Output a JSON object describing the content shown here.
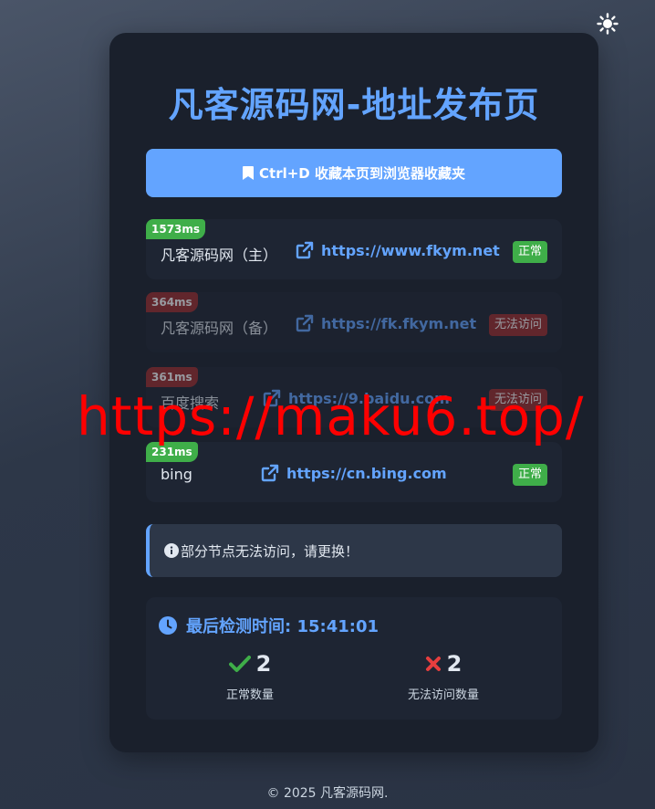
{
  "header": {
    "title": "凡客源码网-地址发布页"
  },
  "bookmark": {
    "label": "Ctrl+D 收藏本页到浏览器收藏夹"
  },
  "links": [
    {
      "latency": "1573ms",
      "name": "凡客源码网（主）",
      "url": "https://www.fkym.net",
      "status": "正常"
    },
    {
      "latency": "364ms",
      "name": "凡客源码网（备）",
      "url": "https://fk.fkym.net",
      "status": "无法访问"
    },
    {
      "latency": "361ms",
      "name": "百度搜索",
      "url": "https://9.baidu.com",
      "status": "无法访问"
    },
    {
      "latency": "231ms",
      "name": "bing",
      "url": "https://cn.bing.com",
      "status": "正常"
    }
  ],
  "notice": {
    "text": "部分节点无法访问，请更换！"
  },
  "stats": {
    "check_time": "最后检测时间: 15:41:01",
    "ok_count": "2",
    "ok_label": "正常数量",
    "bad_count": "2",
    "bad_label": "无法访问数量"
  },
  "footer": {
    "text": "© 2025 凡客源码网."
  },
  "watermark": {
    "text": "https://maku6.top/"
  },
  "colors": {
    "accent": "#63a4ff",
    "ok": "#3fae49",
    "bad": "#9b2c2c",
    "watermark": "#ff0000"
  },
  "icons": [
    "sun-icon",
    "bookmark-icon",
    "external-link-icon",
    "info-icon",
    "clock-icon",
    "check-icon",
    "cross-icon"
  ]
}
